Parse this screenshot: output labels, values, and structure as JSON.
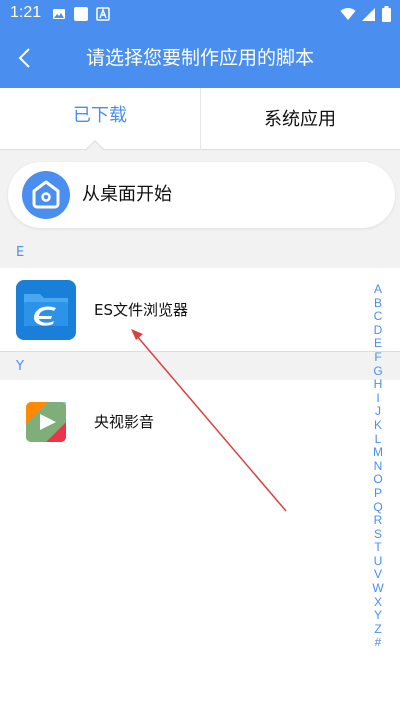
{
  "status_bar": {
    "time": "1:21"
  },
  "app_bar": {
    "title": "请选择您要制作应用的脚本"
  },
  "tabs": [
    {
      "label": "已下载",
      "selected": true
    },
    {
      "label": "系统应用",
      "selected": false
    }
  ],
  "start_from_desktop": {
    "label": "从桌面开始"
  },
  "sections": [
    {
      "letter": "E",
      "apps": [
        {
          "label": "ES文件浏览器",
          "icon": "es-file-explorer-icon"
        }
      ]
    },
    {
      "letter": "Y",
      "apps": [
        {
          "label": "央视影音",
          "icon": "cctv-video-icon"
        }
      ]
    }
  ],
  "index_letters": [
    "A",
    "B",
    "C",
    "D",
    "E",
    "F",
    "G",
    "H",
    "I",
    "J",
    "K",
    "L",
    "M",
    "N",
    "O",
    "P",
    "Q",
    "R",
    "S",
    "T",
    "U",
    "V",
    "W",
    "X",
    "Y",
    "Z",
    "#"
  ],
  "colors": {
    "accent": "#4a8ff0",
    "arrow": "#d94040"
  }
}
